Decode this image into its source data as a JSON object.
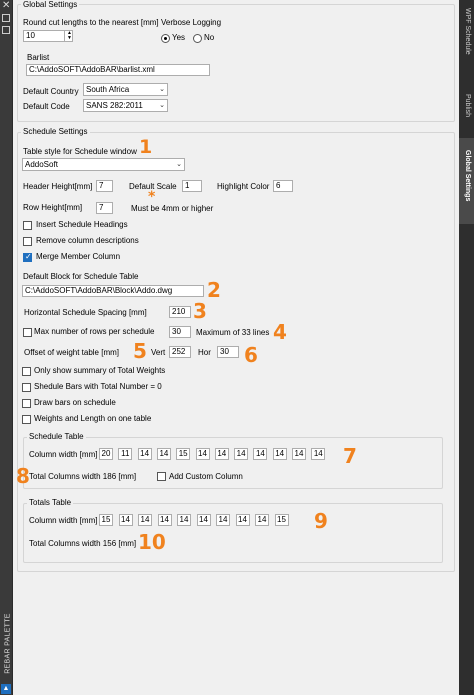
{
  "palette": {
    "label": "REBAR PALETTE",
    "close_glyph": "✕"
  },
  "tabs": [
    "WPF Schedule",
    "Publish",
    "Global Settings"
  ],
  "global": {
    "legend": "Global Settings",
    "round_label": "Round cut lengths to the nearest [mm]",
    "round_value": "10",
    "verbose_label": "Verbose Logging",
    "yes_label": "Yes",
    "no_label": "No",
    "barlist_label": "Barlist",
    "barlist_value": "C:\\AddoSOFT\\AddoBAR\\barlist.xml",
    "country_label": "Default Country",
    "country_value": "South Africa",
    "code_label": "Default Code",
    "code_value": "SANS 282:2011"
  },
  "schedule": {
    "legend": "Schedule Settings",
    "table_style_label": "Table style for Schedule window",
    "table_style_value": "AddoSoft",
    "header_height_label": "Header Height[mm]",
    "header_height_value": "7",
    "default_scale_label": "Default Scale",
    "default_scale_value": "1",
    "highlight_color_label": "Highlight Color",
    "highlight_color_value": "6",
    "row_height_label": "Row Height[mm]",
    "row_height_value": "7",
    "row_height_note": "Must be 4mm or higher",
    "insert_headings_label": "Insert Schedule Headings",
    "remove_desc_label": "Remove column descriptions",
    "merge_member_label": "Merge Member Column",
    "default_block_label": "Default Block for Schedule Table",
    "default_block_value": "C:\\AddoSOFT\\AddoBAR\\Block\\Addo.dwg",
    "hspacing_label": "Horizontal Schedule Spacing [mm]",
    "hspacing_value": "210",
    "max_rows_label": "Max number of rows per schedule",
    "max_rows_value": "30",
    "max_rows_note": "Maximum of 33 lines",
    "offset_label": "Offset of weight table [mm]",
    "vert_label": "Vert",
    "vert_value": "252",
    "hor_label": "Hor",
    "hor_value": "30",
    "only_summary_label": "Only show summary of Total Weights",
    "shedule_total_label": "Shedule Bars with Total Number = 0",
    "draw_bars_label": "Draw bars on schedule",
    "weights_one_table_label": "Weights and Length on one table"
  },
  "schedule_table": {
    "legend": "Schedule Table",
    "col_width_label": "Column width [mm]",
    "widths": [
      "20",
      "11",
      "14",
      "14",
      "15",
      "14",
      "14",
      "14",
      "14",
      "14",
      "14",
      "14"
    ],
    "total_label": "Total Columns width 186 [mm]",
    "add_custom_label": "Add Custom Column"
  },
  "totals_table": {
    "legend": "Totals Table",
    "col_width_label": "Column width [mm]",
    "widths": [
      "15",
      "14",
      "14",
      "14",
      "14",
      "14",
      "14",
      "14",
      "14",
      "15"
    ],
    "total_label": "Total Columns width 156 [mm]"
  },
  "callouts": [
    "1",
    "*",
    "2",
    "3",
    "4",
    "5",
    "6",
    "7",
    "8",
    "9",
    "10"
  ],
  "colors": {
    "callout": "#f0821e",
    "accent": "#1f6fbf"
  }
}
